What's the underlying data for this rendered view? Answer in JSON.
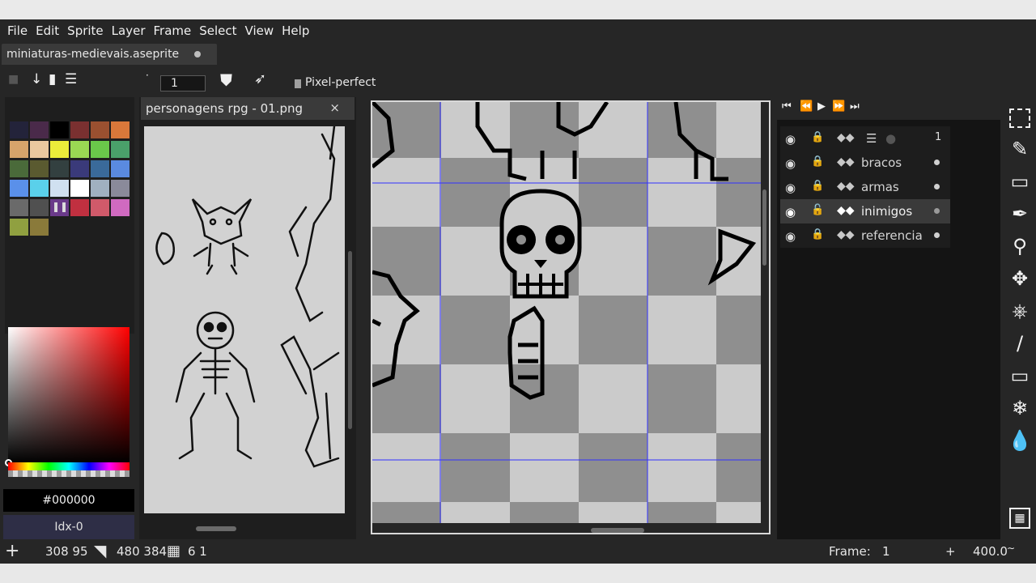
{
  "menubar": {
    "items": [
      "File",
      "Edit",
      "Sprite",
      "Layer",
      "Frame",
      "Select",
      "View",
      "Help"
    ]
  },
  "document": {
    "tab_name": "miniaturas-medievais.aseprite"
  },
  "toolbar": {
    "brush_size": "1",
    "pixel_perfect_label": "Pixel-perfect"
  },
  "palette": {
    "colors": [
      "#23233a",
      "#4a2a4a",
      "#000000",
      "#7a3030",
      "#9a5030",
      "#d9783a",
      "#d7a46b",
      "#eac89f",
      "#ecec3a",
      "#9ad853",
      "#6ac84a",
      "#4aa06a",
      "#4a6a3a",
      "#5a5a30",
      "#334040",
      "#3a3a7a",
      "#3a6a9a",
      "#5a8ae0",
      "#5a90ea",
      "#5ad0ea",
      "#d0e0f0",
      "#ffffff",
      "#a0b0c0",
      "#8a8a9a",
      "#6a6a6a",
      "#505050",
      "#6a3a8a",
      "#c03040",
      "#d05a6a",
      "#d06ac0",
      "#90a040",
      "#8a7a3a"
    ]
  },
  "color": {
    "hex": "#000000",
    "index": "Idx-0"
  },
  "reference": {
    "tab_name": "personagens rpg - 01.png",
    "close_icon": "×"
  },
  "timeline": {
    "frame_column": "1",
    "layers": [
      {
        "name": "bracos",
        "selected": false
      },
      {
        "name": "armas",
        "selected": false
      },
      {
        "name": "inimigos",
        "selected": true
      },
      {
        "name": "referencia",
        "selected": false
      }
    ]
  },
  "tools": [
    "rectangular-marquee-icon",
    "pencil-icon",
    "eraser-icon",
    "eyedropper-icon",
    "zoom-icon",
    "move-icon",
    "paint-bucket-icon",
    "line-icon",
    "rectangle-icon",
    "blur-icon",
    "droplet-icon",
    "tile-icon"
  ],
  "status": {
    "cursor_pos": "308 95",
    "sprite_size": "480 384",
    "grid": "6 1",
    "frame_label": "Frame:",
    "frame_value": "1",
    "zoom_plus": "+",
    "zoom": "400.0"
  }
}
